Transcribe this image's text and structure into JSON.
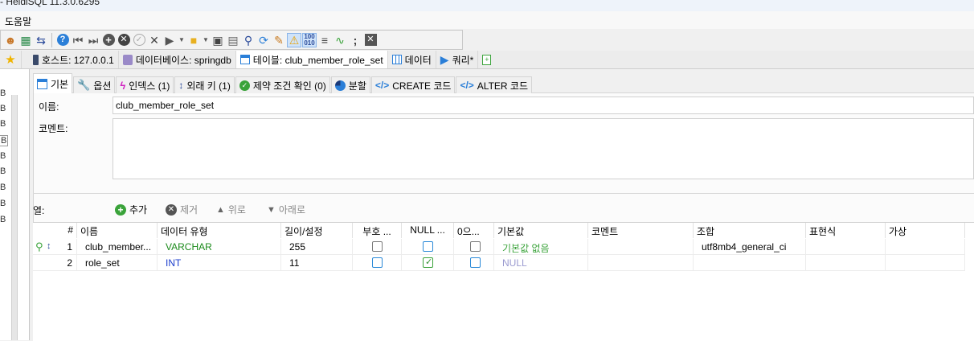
{
  "window": {
    "title": "- HeidiSQL 11.3.0.6295"
  },
  "menu": {
    "help": "도움말"
  },
  "toolbar": {
    "icons": [
      "users-icon",
      "grid-icon",
      "swap-icon",
      "help-icon",
      "first-icon",
      "last-icon",
      "add-icon",
      "delete-icon",
      "confirm-icon",
      "cancel-icon",
      "run-icon",
      "folder-icon",
      "save-icon",
      "print-icon",
      "find-icon",
      "refresh-icon",
      "clean-icon",
      "warning-icon",
      "binary-icon",
      "wrap-icon",
      "format-icon",
      "semicolon-icon",
      "close-icon"
    ],
    "binary_label": "100 010"
  },
  "tabs": [
    {
      "label": "호스트: 127.0.0.1"
    },
    {
      "label": "데이터베이스: springdb"
    },
    {
      "label": "테이블: club_member_role_set"
    },
    {
      "label": "데이터"
    },
    {
      "label": "쿼리*"
    }
  ],
  "left": {
    "labels": [
      "B",
      "B",
      "B",
      "B",
      "B",
      "B",
      "B",
      "B",
      "B"
    ]
  },
  "subtabs": [
    {
      "label": "기본"
    },
    {
      "label": "옵션"
    },
    {
      "label": "인덱스 (1)"
    },
    {
      "label": "외래 키 (1)"
    },
    {
      "label": "제약 조건 확인 (0)"
    },
    {
      "label": "분할"
    },
    {
      "label": "CREATE 코드"
    },
    {
      "label": "ALTER 코드"
    }
  ],
  "form": {
    "name_label": "이름:",
    "name_value": "club_member_role_set",
    "comment_label": "코멘트:"
  },
  "columns_bar": {
    "label": "열:",
    "add": "추가",
    "remove": "제거",
    "up": "위로",
    "down": "아래로"
  },
  "grid": {
    "headers": [
      "#",
      "이름",
      "데이터 유형",
      "길이/설정",
      "부호 ...",
      "NULL ...",
      "0으...",
      "기본값",
      "코멘트",
      "조합",
      "표현식",
      "가상"
    ],
    "rows": [
      {
        "num": "1",
        "name": "club_member...",
        "type": "VARCHAR",
        "length": "255",
        "unsigned": false,
        "allow_null": false,
        "zerofill": false,
        "default": "기본값 없음",
        "comment": "",
        "collation": "utf8mb4_general_ci",
        "expression": "",
        "virtual": ""
      },
      {
        "num": "2",
        "name": "role_set",
        "type": "INT",
        "length": "11",
        "unsigned": false,
        "allow_null": true,
        "zerofill": false,
        "default": "NULL",
        "comment": "",
        "collation": "",
        "expression": "",
        "virtual": ""
      }
    ]
  },
  "colors": {
    "varchar": "#1a8a1a",
    "int": "#1a3ccc",
    "default_none": "#3aa33a",
    "null": "#9a9ad0"
  }
}
